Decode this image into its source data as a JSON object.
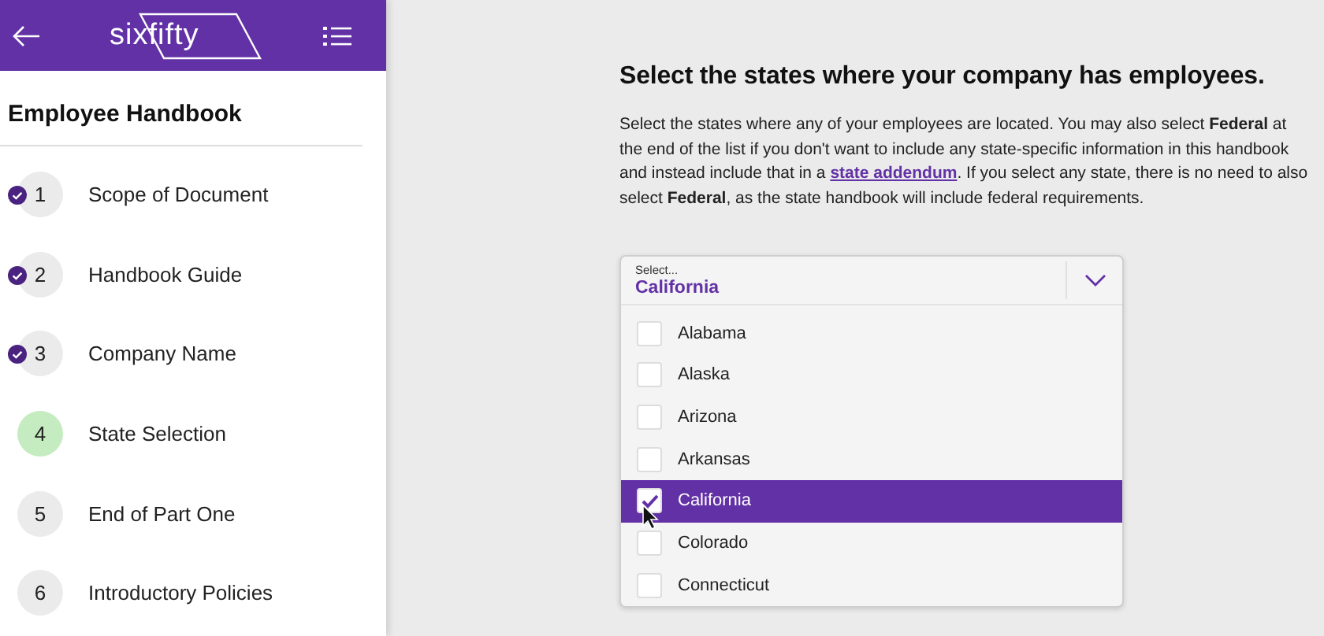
{
  "header": {
    "logo": "sixfifty"
  },
  "sidebar": {
    "title": "Employee Handbook",
    "steps": [
      {
        "number": "1",
        "label": "Scope of Document",
        "completed": true,
        "selected": false
      },
      {
        "number": "2",
        "label": "Handbook Guide",
        "completed": true,
        "selected": false
      },
      {
        "number": "3",
        "label": "Company Name",
        "completed": true,
        "selected": false
      },
      {
        "number": "4",
        "label": "State Selection",
        "completed": false,
        "selected": true
      },
      {
        "number": "5",
        "label": "End of Part One",
        "completed": false,
        "selected": false
      },
      {
        "number": "6",
        "label": "Introductory Policies",
        "completed": false,
        "selected": false
      }
    ]
  },
  "main": {
    "heading": "Select the states where your company has employees.",
    "intro": {
      "before": "Select the states where any of your employees are located. You may also select **Federal** at the end of the list if you don't want to include any state-specific information in this handbook and instead include that in a ",
      "link": "state addendum",
      "after": ". If you select any state, there is no need to also select **Federal**, as the state handbook will include federal requirements."
    },
    "select": {
      "label": "Select...",
      "value": "California",
      "expanded": true,
      "options": [
        {
          "label": "Alabama",
          "checked": false,
          "selected": false
        },
        {
          "label": "Alaska",
          "checked": false,
          "selected": false
        },
        {
          "label": "Arizona",
          "checked": false,
          "selected": false
        },
        {
          "label": "Arkansas",
          "checked": false,
          "selected": false
        },
        {
          "label": "California",
          "checked": true,
          "selected": true
        },
        {
          "label": "Colorado",
          "checked": false,
          "selected": false
        },
        {
          "label": "Connecticut",
          "checked": false,
          "selected": false
        }
      ]
    }
  }
}
